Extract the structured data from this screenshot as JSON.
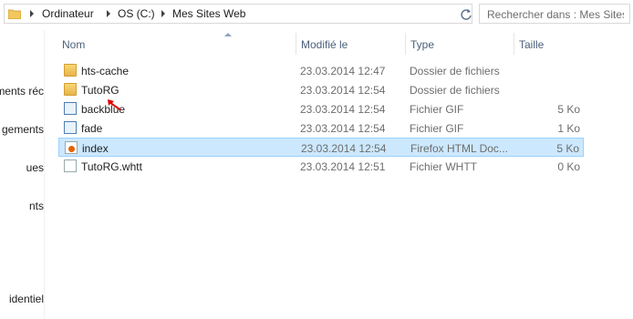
{
  "address": {
    "crumbs": [
      "Ordinateur",
      "OS (C:)",
      "Mes Sites Web"
    ]
  },
  "search": {
    "placeholder": "Rechercher dans : Mes Sites ..."
  },
  "nav": {
    "items": [
      "ments réc",
      "gements",
      "ues",
      "nts",
      "identiel"
    ]
  },
  "columns": {
    "name": "Nom",
    "modified": "Modifié le",
    "type": "Type",
    "size": "Taille"
  },
  "files": [
    {
      "name": "hts-cache",
      "modified": "23.03.2014 12:47",
      "type": "Dossier de fichiers",
      "size": "",
      "icon": "folder-icon"
    },
    {
      "name": "TutoRG",
      "modified": "23.03.2014 12:54",
      "type": "Dossier de fichiers",
      "size": "",
      "icon": "folder-icon"
    },
    {
      "name": "backblue",
      "modified": "23.03.2014 12:54",
      "type": "Fichier GIF",
      "size": "5 Ko",
      "icon": "gif-image-icon"
    },
    {
      "name": "fade",
      "modified": "23.03.2014 12:54",
      "type": "Fichier GIF",
      "size": "1 Ko",
      "icon": "gif-image-icon"
    },
    {
      "name": "index",
      "modified": "23.03.2014 12:54",
      "type": "Firefox HTML Doc...",
      "size": "5 Ko",
      "icon": "firefox-html-icon"
    },
    {
      "name": "TutoRG.whtt",
      "modified": "23.03.2014 12:51",
      "type": "Fichier WHTT",
      "size": "0 Ko",
      "icon": "file-icon"
    }
  ],
  "colors": {
    "selection_bg": "#cce8ff",
    "selection_border": "#99d1ff",
    "header_text": "#4c607a",
    "cursor": "#e00000"
  }
}
